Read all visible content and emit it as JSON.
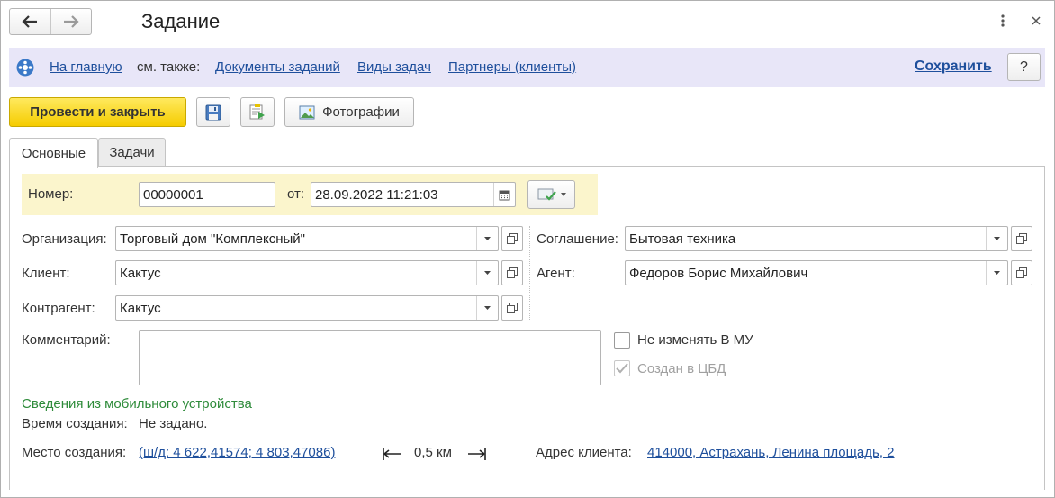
{
  "window": {
    "title": "Задание",
    "icons": {
      "back": "arrow-left-icon",
      "forward": "arrow-right-icon",
      "more": "more-vertical-icon",
      "close": "close-icon"
    }
  },
  "commandbar": {
    "home_link": "На главную",
    "see_also_label": "см. также:",
    "links": [
      "Документы заданий",
      "Виды задач",
      "Партнеры (клиенты)"
    ],
    "save_link": "Сохранить",
    "help_label": "?",
    "background": "#e8e6f8"
  },
  "toolbar": {
    "post_close_label": "Провести и закрыть",
    "photos_label": "Фотографии",
    "accent": "#f5cc00"
  },
  "tabs": [
    {
      "label": "Основные",
      "active": true
    },
    {
      "label": "Задачи",
      "active": false
    }
  ],
  "form": {
    "number_label": "Номер:",
    "number_value": "00000001",
    "date_label": "от:",
    "date_value": "28.09.2022 11:21:03",
    "organization_label": "Организация:",
    "organization_value": "Торговый дом \"Комплексный\"",
    "client_label": "Клиент:",
    "client_value": "Кактус",
    "counterparty_label": "Контрагент:",
    "counterparty_value": "Кактус",
    "agreement_label": "Соглашение:",
    "agreement_value": "Бытовая техника",
    "agent_label": "Агент:",
    "agent_value": "Федоров Борис Михайлович",
    "comment_label": "Комментарий:",
    "comment_value": "",
    "no_change_label": "Не изменять В МУ",
    "no_change_checked": false,
    "created_cbd_label": "Создан в ЦБД",
    "created_cbd_checked": true
  },
  "mobile": {
    "section_title": "Сведения из мобильного устройства",
    "creation_time_label": "Время создания:",
    "creation_time_value": "Не задано.",
    "creation_place_label": "Место создания:",
    "creation_place_link": "(ш/д: 4 622,41574; 4 803,47086)",
    "distance_value": "0,5 км",
    "client_address_label": "Адрес клиента:",
    "client_address_link": "414000, Астрахань, Ленина площадь, 2"
  }
}
